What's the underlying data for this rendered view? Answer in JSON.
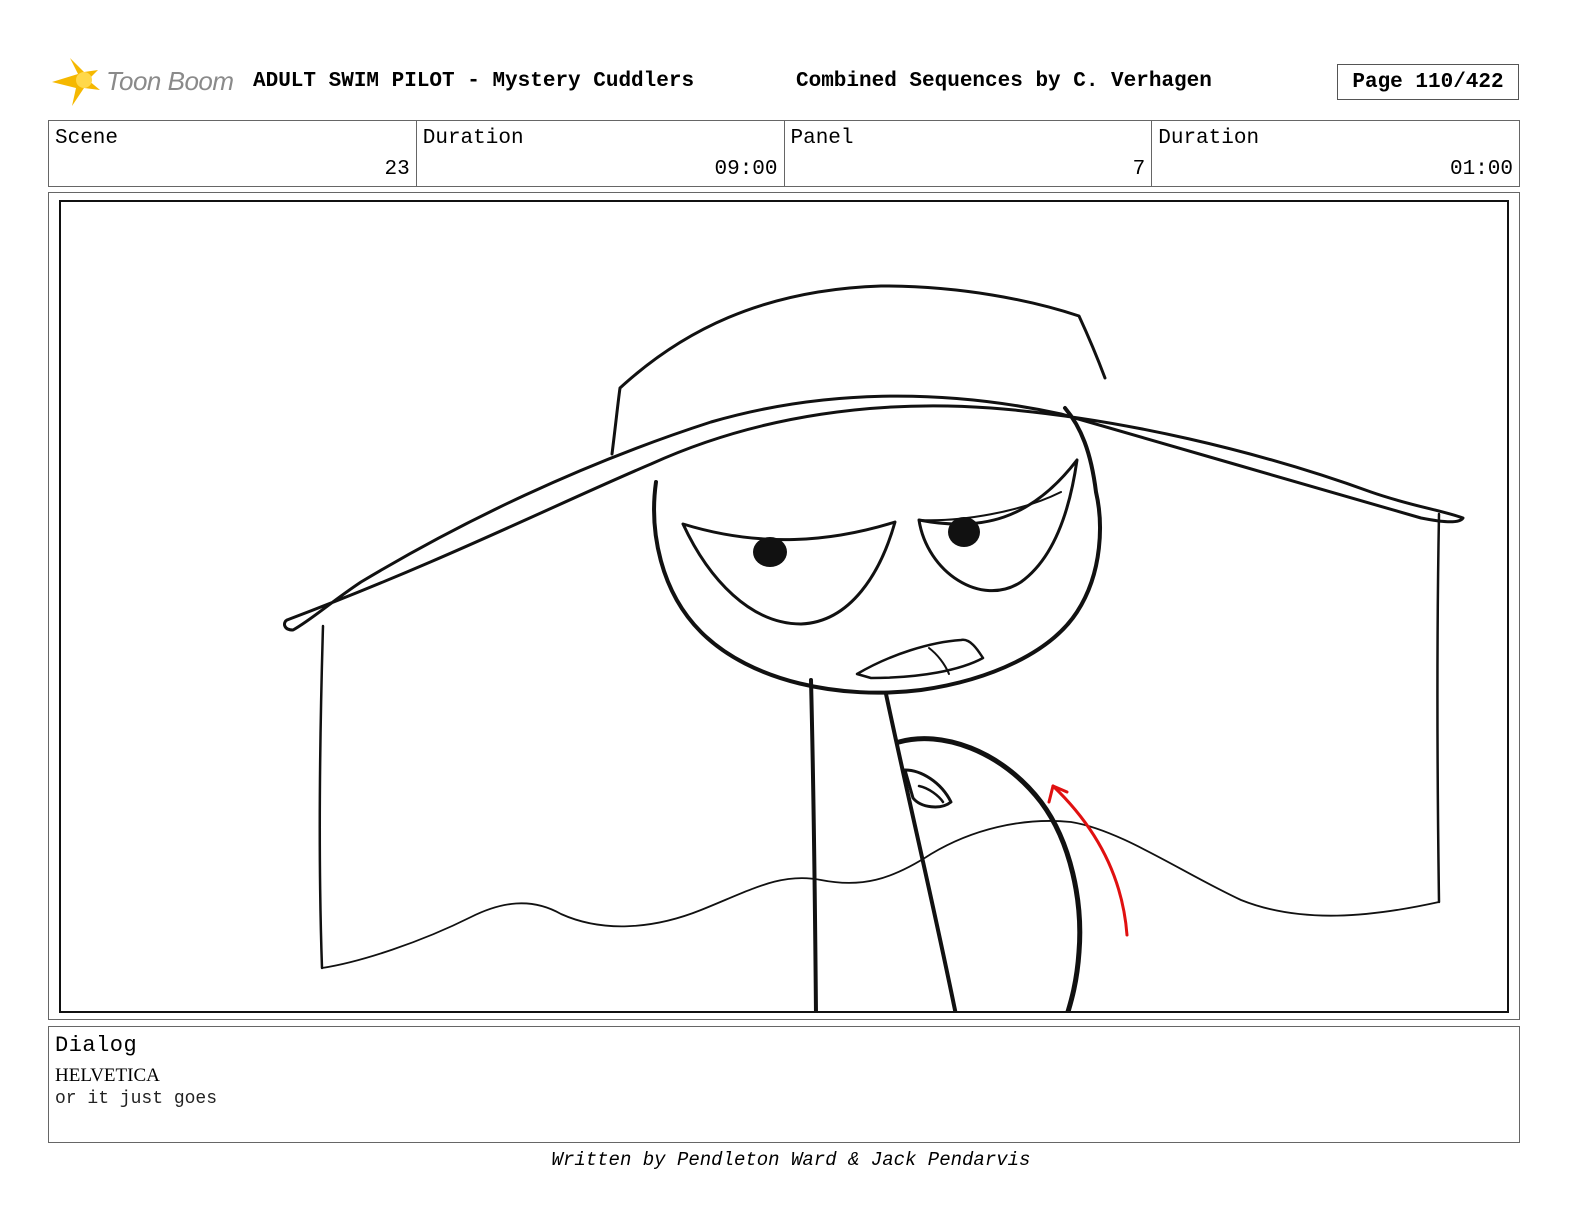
{
  "header": {
    "logo_text": "Toon Boom",
    "title": "ADULT SWIM PILOT - Mystery Cuddlers",
    "subtitle": "Combined Sequences by C. Verhagen",
    "page": "Page 110/422"
  },
  "info": [
    {
      "label": "Scene",
      "value": "23"
    },
    {
      "label": "Duration",
      "value": "09:00"
    },
    {
      "label": "Panel",
      "value": "7"
    },
    {
      "label": "Duration",
      "value": "01:00"
    }
  ],
  "dialog": {
    "label": "Dialog",
    "speaker": "HELVETICA",
    "line": "or it just goes"
  },
  "footer": "Written by Pendleton Ward & Jack Pendarvis",
  "colors": {
    "ink": "#111111",
    "arrow": "#e01010",
    "logo_star": "#f5b800",
    "logo_text": "#8a8a8a"
  }
}
